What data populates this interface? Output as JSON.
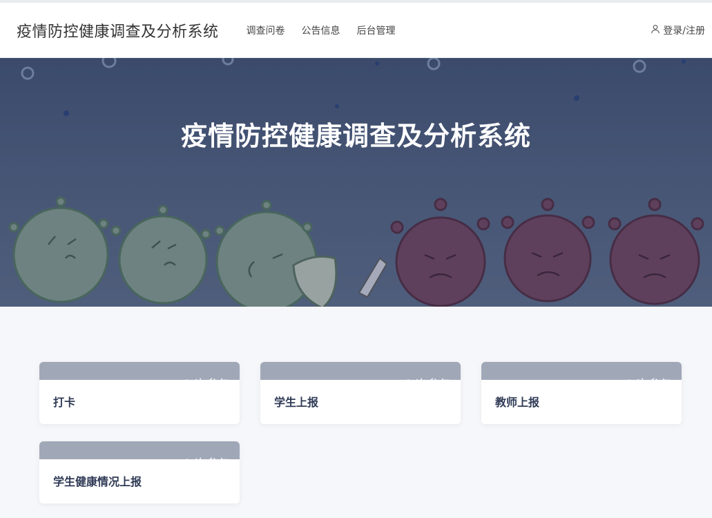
{
  "nav": {
    "brand": "疫情防控健康调查及分析系统",
    "links": [
      "调查问卷",
      "公告信息",
      "后台管理"
    ],
    "login": "登录/注册"
  },
  "hero": {
    "title": "疫情防控健康调查及分析系统"
  },
  "cards": [
    {
      "name": "打卡",
      "count": "1 次参与"
    },
    {
      "name": "学生上报",
      "count": "0 次参与"
    },
    {
      "name": "教师上报",
      "count": "0 次参与"
    },
    {
      "name": "学生健康情况上报",
      "count": "0 次参与"
    }
  ],
  "colors": {
    "hero_bg": "#4a5878",
    "card_band": "#a0a8b8",
    "card_title": "#2f3a55"
  }
}
